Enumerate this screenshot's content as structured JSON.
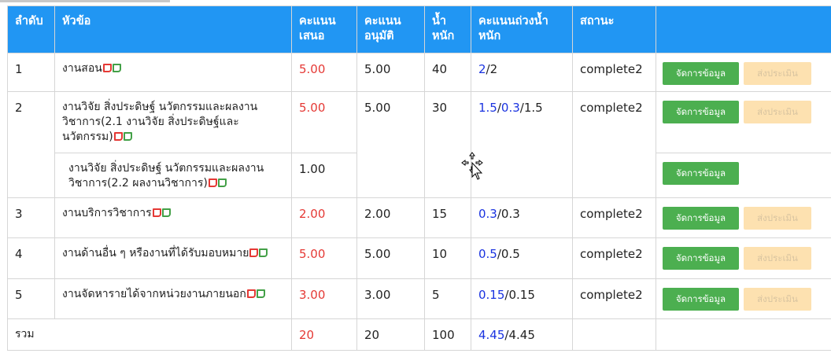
{
  "headers": {
    "no": "ลำดับ",
    "topic": "หัวข้อ",
    "proposed": "คะแนน เสนอ",
    "approved": "คะแนน อนุมัติ",
    "weight": "น้ำ หนัก",
    "weighted": "คะแนนถ่วงน้ำ หนัก",
    "status": "สถานะ"
  },
  "rows": [
    {
      "no": "1",
      "topic": "งานสอน",
      "proposed": "5.00",
      "approved": "5.00",
      "weight": "40",
      "weighted_a": "2",
      "weighted_b": "2",
      "status": "complete2"
    },
    {
      "no": "2",
      "topic": "งานวิจัย สิ่งประดิษฐ์ นวัตกรรมและผลงานวิชาการ(2.1 งานวิจัย สิ่งประดิษฐ์และนวัตกรรม)",
      "proposed": "5.00",
      "approved": "5.00",
      "weight": "30",
      "weighted_a": "1.5",
      "weighted_mid": "0.3",
      "weighted_b": "1.5",
      "status": "complete2"
    },
    {
      "topic": "งานวิจัย สิ่งประดิษฐ์ นวัตกรรมและผลงานวิชาการ(2.2 ผลงานวิชาการ)",
      "proposed": "1.00"
    },
    {
      "no": "3",
      "topic": "งานบริการวิชาการ",
      "proposed": "2.00",
      "approved": "2.00",
      "weight": "15",
      "weighted_a": "0.3",
      "weighted_b": "0.3",
      "status": "complete2"
    },
    {
      "no": "4",
      "topic": "งานด้านอื่น ๆ หรืองานที่ได้รับมอบหมาย",
      "proposed": "5.00",
      "approved": "5.00",
      "weight": "10",
      "weighted_a": "0.5",
      "weighted_b": "0.5",
      "status": "complete2"
    },
    {
      "no": "5",
      "topic": "งานจัดหารายได้จากหน่วยงานภายนอก",
      "proposed": "3.00",
      "approved": "3.00",
      "weight": "5",
      "weighted_a": "0.15",
      "weighted_b": "0.15",
      "status": "complete2"
    }
  ],
  "total": {
    "label": "รวม",
    "proposed": "20",
    "approved": "20",
    "weight": "100",
    "weighted_a": "4.45",
    "weighted_b": "4.45"
  },
  "buttons": {
    "manage": "จัดการข้อมูล",
    "submit": "ส่งประเมิน"
  },
  "slash": "/",
  "colors": {
    "header_bg": "#2196f3",
    "manage_btn": "#4caf50",
    "submit_btn_disabled": "#fde1b0",
    "proposed_text": "#e53935",
    "weighted_text": "#1a33e0"
  },
  "icons": {
    "red": "edit-note-icon",
    "green": "view-note-icon"
  }
}
